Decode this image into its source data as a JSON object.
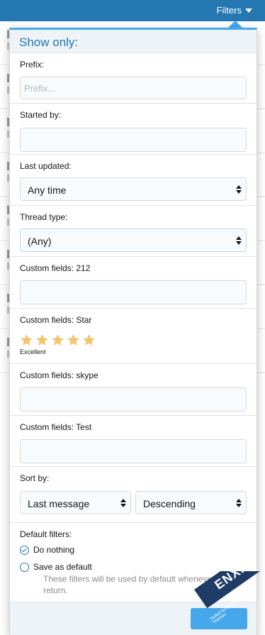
{
  "topbar": {
    "filters_label": "Filters"
  },
  "menu": {
    "header_title": "Show only:",
    "prefix": {
      "label": "Prefix:",
      "placeholder": "Prefix..."
    },
    "started_by": {
      "label": "Started by:",
      "value": ""
    },
    "last_updated": {
      "label": "Last updated:",
      "selected": "Any time"
    },
    "thread_type": {
      "label": "Thread type:",
      "selected": "(Any)"
    },
    "cf_212": {
      "label": "Custom fields: 212",
      "value": ""
    },
    "cf_star": {
      "label": "Custom fields: Star",
      "rating": 5,
      "max": 5,
      "caption": "Excellent",
      "star_color": "#f6c36b"
    },
    "cf_skype": {
      "label": "Custom fields: skype",
      "value": ""
    },
    "cf_test": {
      "label": "Custom fields: Test",
      "value": ""
    },
    "sort_by": {
      "label": "Sort by:",
      "field": "Last message",
      "direction": "Descending"
    },
    "default_filters": {
      "label": "Default filters:",
      "options": [
        {
          "label": "Do nothing",
          "checked": true
        },
        {
          "label": "Save as default",
          "checked": false
        }
      ],
      "hint": "These filters will be used by default whenever you return."
    }
  },
  "watermark": {
    "text": "ENXF.NET",
    "subtext": "Nulled Scripts & Premium Themes"
  },
  "colors": {
    "accent": "#2577b1",
    "accent_light": "#47a7eb",
    "header_bg": "#eef3f8"
  }
}
